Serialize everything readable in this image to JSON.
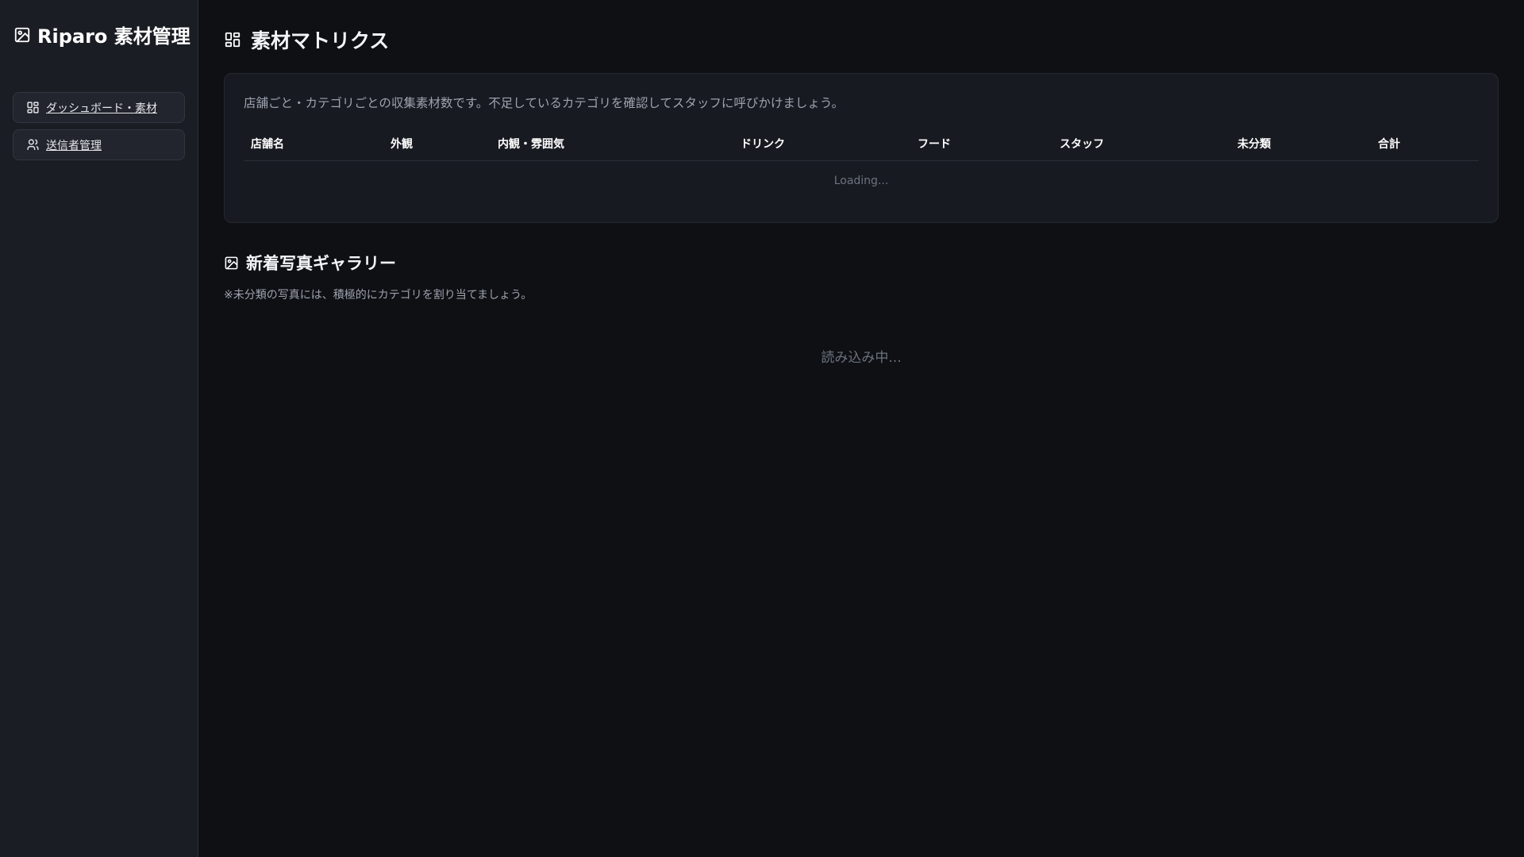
{
  "sidebar": {
    "brand": "Riparo 素材管理",
    "items": [
      {
        "label": "ダッシュボード・素材",
        "icon": "dashboard-icon"
      },
      {
        "label": "送信者管理",
        "icon": "users-icon"
      }
    ]
  },
  "matrix": {
    "title": "素材マトリクス",
    "description": "店舗ごと・カテゴリごとの収集素材数です。不足しているカテゴリを確認してスタッフに呼びかけましょう。",
    "columns": [
      "店舗名",
      "外観",
      "内観・雰囲気",
      "ドリンク",
      "フード",
      "スタッフ",
      "未分類",
      "合計"
    ],
    "loading": "Loading..."
  },
  "gallery": {
    "title": "新着写真ギャラリー",
    "note": "※未分類の写真には、積極的にカテゴリを割り当てましょう。",
    "loading": "読み込み中..."
  }
}
